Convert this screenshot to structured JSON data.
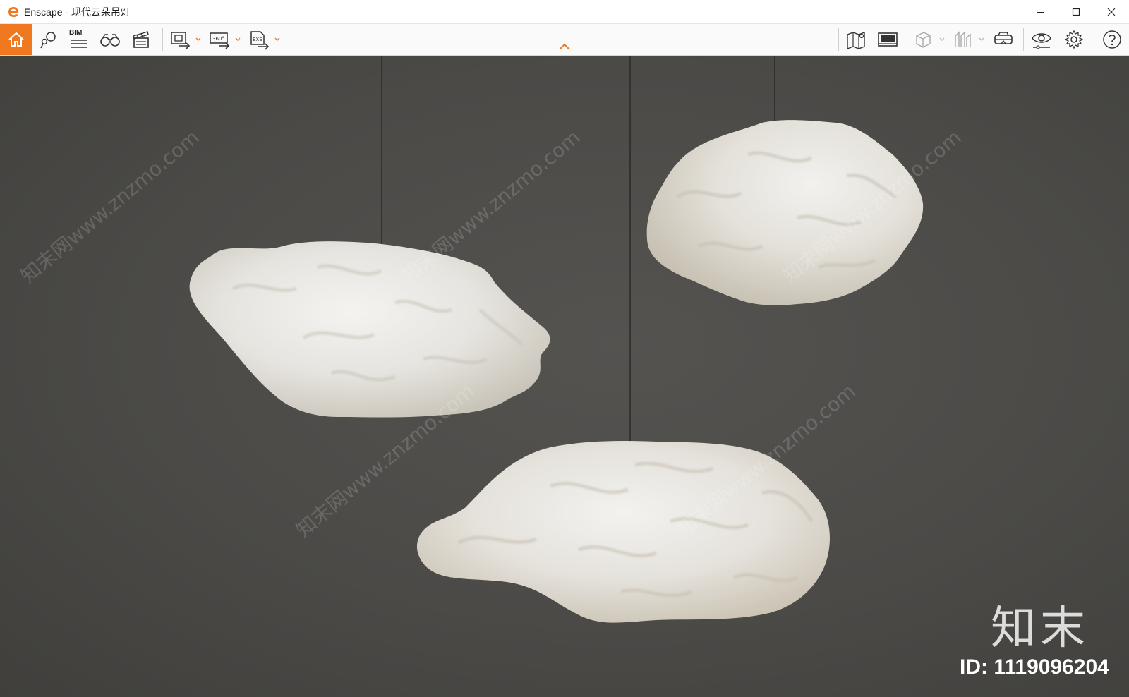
{
  "window": {
    "title": "Enscape - 现代云朵吊灯",
    "controls": [
      "minimize-icon",
      "maximize-icon",
      "close-icon"
    ]
  },
  "toolbar": {
    "left_tools": [
      "home-icon",
      "views-icon",
      "bim-icon",
      "binoculars-icon",
      "video-editor-icon",
      "screenshot-export-icon",
      "panorama-export-icon",
      "exe-export-icon"
    ],
    "bim_label": "BIM",
    "panorama_label": "360°",
    "exe_label": "EXE",
    "right_tools": [
      "map-icon",
      "asset-library-icon",
      "cube-icon",
      "section-icon",
      "vr-headset-icon",
      "visual-settings-icon",
      "settings-icon",
      "help-icon"
    ],
    "accent_color": "#f0781e"
  },
  "viewport": {
    "watermark_text": "知末网www.znzmo.com",
    "brand_mark": "知末",
    "asset_id": "ID: 1119096204"
  }
}
